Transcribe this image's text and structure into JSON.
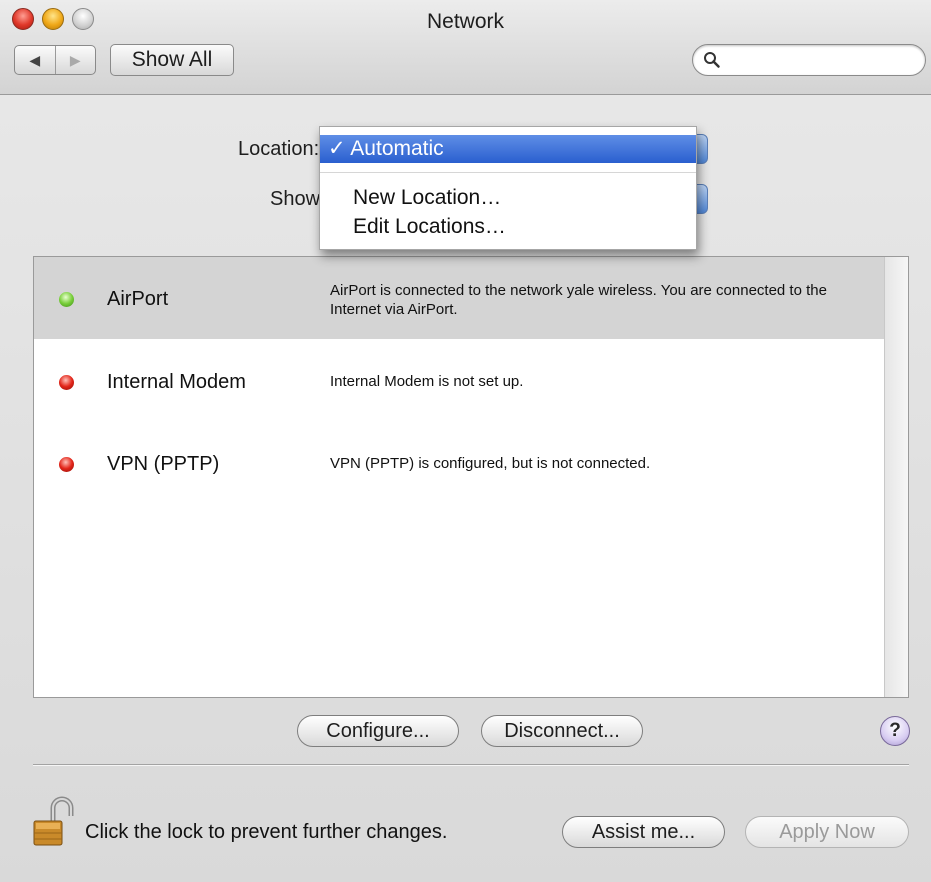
{
  "window": {
    "title": "Network"
  },
  "toolbar": {
    "back_glyph": "◀",
    "forward_glyph": "▶",
    "show_all_label": "Show All",
    "search_placeholder": ""
  },
  "location": {
    "label": "Location:",
    "menu": {
      "selected": "Automatic",
      "check_glyph": "✓",
      "items": [
        "New Location…",
        "Edit Locations…"
      ]
    }
  },
  "show": {
    "label": "Show:"
  },
  "services": [
    {
      "name": "AirPort",
      "status": "green",
      "selected": true,
      "description": "AirPort is connected to the network yale wireless. You are connected to the Internet via AirPort."
    },
    {
      "name": "Internal Modem",
      "status": "red",
      "selected": false,
      "description": "Internal Modem is not set up."
    },
    {
      "name": "VPN (PPTP)",
      "status": "red",
      "selected": false,
      "description": "VPN (PPTP) is configured, but is not connected."
    }
  ],
  "actions": {
    "configure_label": "Configure...",
    "disconnect_label": "Disconnect...",
    "help_label": "?"
  },
  "footer": {
    "lock_message": "Click the lock to prevent further changes.",
    "assist_label": "Assist me...",
    "apply_label": "Apply Now"
  },
  "colors": {
    "selection_blue": "#2a5fcf",
    "status_green": "#79cf3b",
    "status_red": "#e3261a"
  }
}
